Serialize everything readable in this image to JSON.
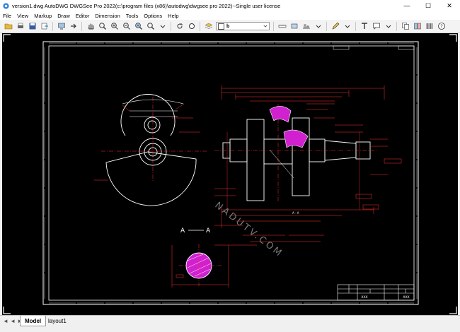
{
  "window": {
    "title": "version1.dwg AutoDWG DWGSee Pro 2022(c:\\program files (x86)\\autodwg\\dwgsee pro 2022)--Single user license",
    "minimize": "—",
    "maximize": "☐",
    "close": "✕"
  },
  "menu": [
    "File",
    "View",
    "Markup",
    "Draw",
    "Editor",
    "Dimension",
    "Tools",
    "Options",
    "Help"
  ],
  "toolbar": {
    "layer_value": "b"
  },
  "drawing": {
    "section_label_left": "A",
    "section_label_right": "A",
    "title_block_name": "XXX",
    "title_block_sub": "XXX",
    "watermark": "NADUTV.COM",
    "detail_label": "A - A"
  },
  "tabs": {
    "nav": "◄ ◄ ► ►",
    "items": [
      {
        "label": "Model",
        "active": true
      },
      {
        "label": "layout1",
        "active": false
      }
    ]
  },
  "colors": {
    "canvas": "#000000",
    "line_white": "#ffffff",
    "line_red": "#ff3030",
    "hatch_magenta": "#d020d0"
  }
}
